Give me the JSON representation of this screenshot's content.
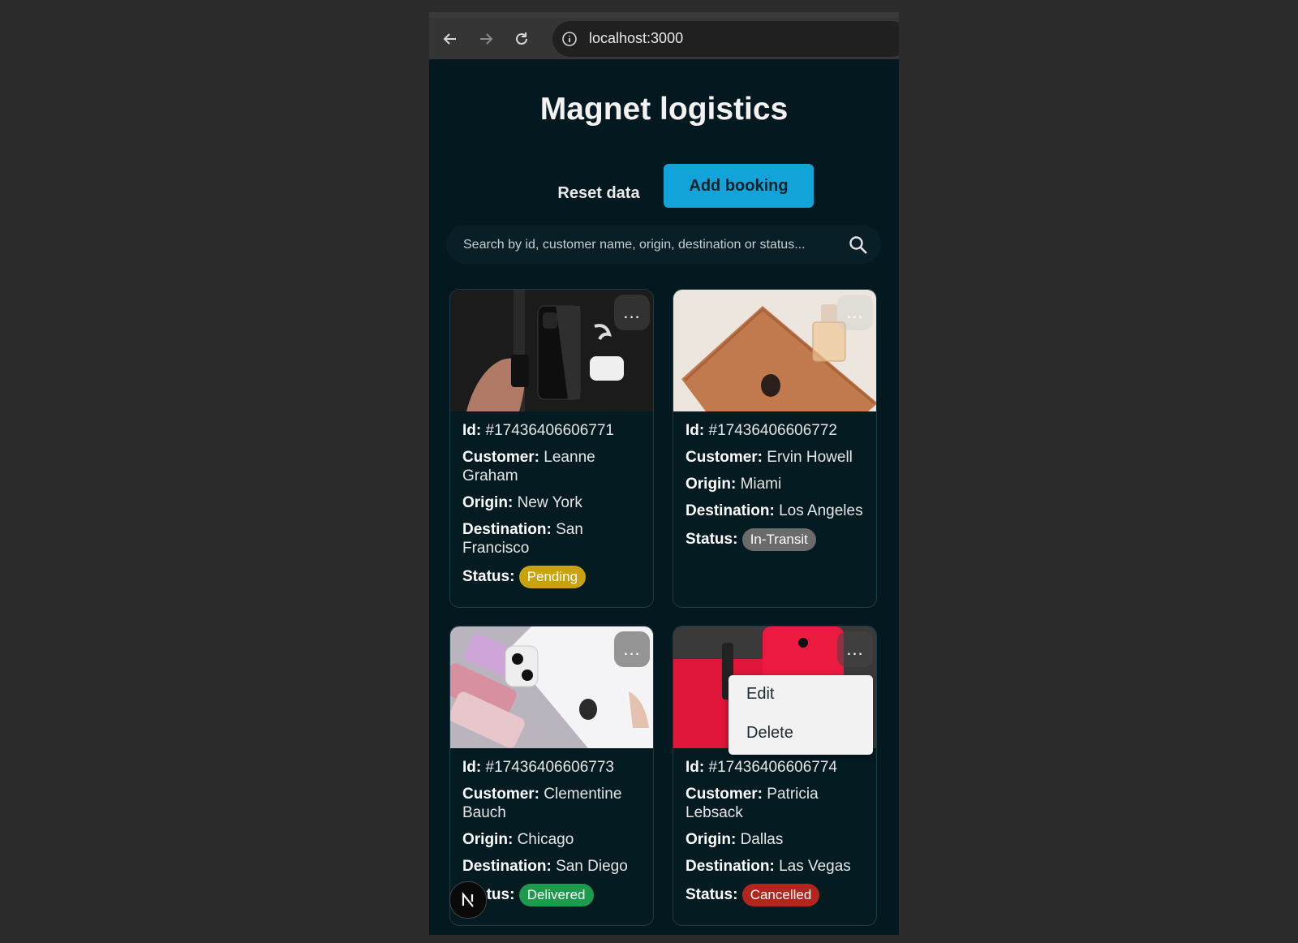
{
  "browser": {
    "url": "localhost:3000",
    "icons": [
      "back-arrow-icon",
      "forward-arrow-icon",
      "reload-icon",
      "info-icon"
    ]
  },
  "page": {
    "title": "Magnet logistics",
    "reset_label": "Reset data",
    "add_label": "Add booking",
    "search_placeholder": "Search by id, customer name, origin, destination or status..."
  },
  "labels": {
    "id": "Id:",
    "customer": "Customer:",
    "origin": "Origin:",
    "destination": "Destination:",
    "status": "Status:"
  },
  "bookings": [
    {
      "id": "#17436406606771",
      "customer": "Leanne Graham",
      "origin": "New York",
      "destination": "San Francisco",
      "status": "Pending",
      "status_color": "#c9a20f"
    },
    {
      "id": "#17436406606772",
      "customer": "Ervin Howell",
      "origin": "Miami",
      "destination": "Los Angeles",
      "status": "In-Transit",
      "status_color": "#6b6b6b"
    },
    {
      "id": "#17436406606773",
      "customer": "Clementine Bauch",
      "origin": "Chicago",
      "destination": "San Diego",
      "status": "Delivered",
      "status_color": "#1e9a4c"
    },
    {
      "id": "#17436406606774",
      "customer": "Patricia Lebsack",
      "origin": "Dallas",
      "destination": "Las Vegas",
      "status": "Cancelled",
      "status_color": "#b3261e"
    }
  ],
  "context_menu": {
    "edit": "Edit",
    "delete": "Delete"
  },
  "more_glyph": "...",
  "colors": {
    "accent": "#12a4d9",
    "page_bg": "#04191f"
  }
}
